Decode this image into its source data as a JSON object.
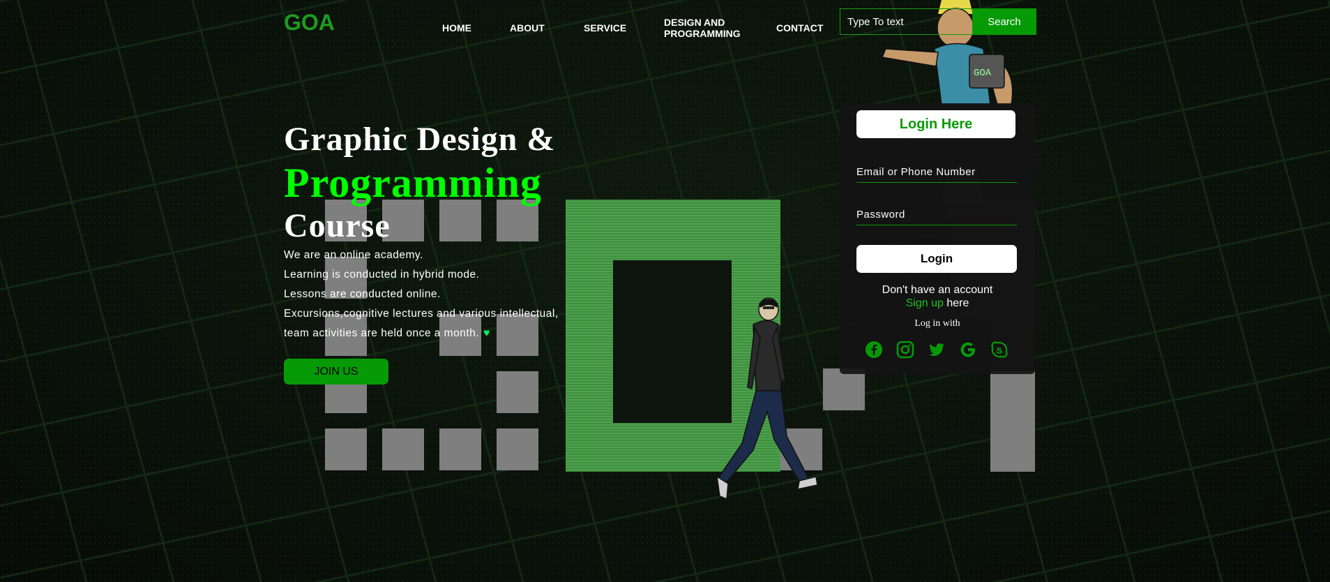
{
  "brand": {
    "logo": "GOA"
  },
  "nav": {
    "items": [
      "HOME",
      "ABOUT",
      "SERVICE",
      "DESIGN AND",
      "PROGRAMMING",
      "CONTACT"
    ]
  },
  "search": {
    "placeholder": "Type To text",
    "button": "Search"
  },
  "hero": {
    "line1": "Graphic Design &",
    "line2": "Programming",
    "line3": "Course",
    "desc": [
      "We are an online academy.",
      "Learning is conducted in hybrid mode.",
      "Lessons are conducted online.",
      "Excursions,cognitive lectures and various intellectual,",
      "team activities are held once a month."
    ],
    "join": "JOIN US"
  },
  "login": {
    "title": "Login Here",
    "email_placeholder": "Email or Phone Number",
    "password_placeholder": "Password",
    "button": "Login",
    "no_account": "Don't have an account",
    "signup_link": "Sign up",
    "signup_suffix": "here",
    "log_in_with": "Log in with",
    "socials": [
      "facebook-icon",
      "instagram-icon",
      "twitter-icon",
      "google-icon",
      "skype-icon"
    ]
  },
  "colors": {
    "accent": "#069a06",
    "bright": "#00ff00"
  }
}
